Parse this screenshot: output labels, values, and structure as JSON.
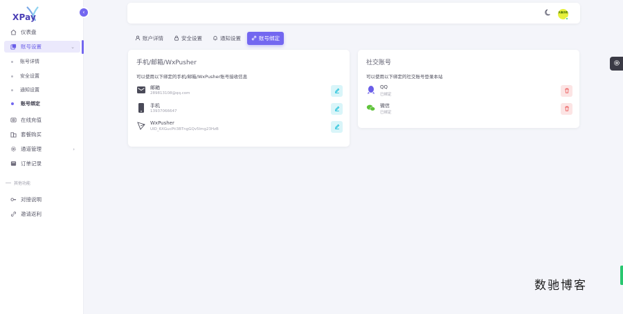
{
  "brand": {
    "name": "XPay",
    "accent": "#7367f0"
  },
  "sidebar": {
    "items": [
      {
        "label": "仪表盘",
        "icon": "home-icon"
      },
      {
        "label": "账号设置",
        "icon": "account-settings-icon"
      },
      {
        "label": "在线充值",
        "icon": "recharge-icon"
      },
      {
        "label": "套餐购买",
        "icon": "package-icon"
      },
      {
        "label": "通道管理",
        "icon": "channel-gear-icon"
      },
      {
        "label": "订单记录",
        "icon": "orders-icon"
      }
    ],
    "sub_items": [
      {
        "label": "账号详情"
      },
      {
        "label": "安全设置"
      },
      {
        "label": "通知设置"
      },
      {
        "label": "账号绑定"
      }
    ],
    "section_title": "其他功能",
    "other_items": [
      {
        "label": "对接说明",
        "icon": "key-icon"
      },
      {
        "label": "邀请返利",
        "icon": "link-icon"
      }
    ]
  },
  "topbar": {
    "avatar_text": "头像示例"
  },
  "tabs": [
    {
      "label": "账户详情",
      "icon": "user-icon"
    },
    {
      "label": "安全设置",
      "icon": "lock-icon"
    },
    {
      "label": "通知设置",
      "icon": "bell-icon"
    },
    {
      "label": "账号绑定",
      "icon": "link-icon"
    }
  ],
  "contact_card": {
    "title": "手机/邮箱/WxPusher",
    "description": "可以使用以下绑定的手机/邮箱/WxPusher账号接收信息",
    "rows": [
      {
        "name": "邮箱",
        "value": "289813108@qq.com",
        "icon": "mail-icon"
      },
      {
        "name": "手机",
        "value": "13937066647",
        "icon": "phone-icon"
      },
      {
        "name": "WxPusher",
        "value": "UID_6XGucPti3BTngGQv5lmg23HzB",
        "icon": "wxpusher-icon"
      }
    ]
  },
  "social_card": {
    "title": "社交账号",
    "description": "可以使用以下绑定的社交账号登录本站",
    "rows": [
      {
        "name": "QQ",
        "value": "已绑定",
        "icon": "qq-icon"
      },
      {
        "name": "微信",
        "value": "已绑定",
        "icon": "wechat-icon"
      }
    ]
  },
  "watermark": "数驰博客",
  "colors": {
    "accent": "#7367f0",
    "info": "#00b8d4",
    "danger": "#ea5455",
    "qq": "#6a5ee8",
    "wechat": "#5fc33a"
  }
}
